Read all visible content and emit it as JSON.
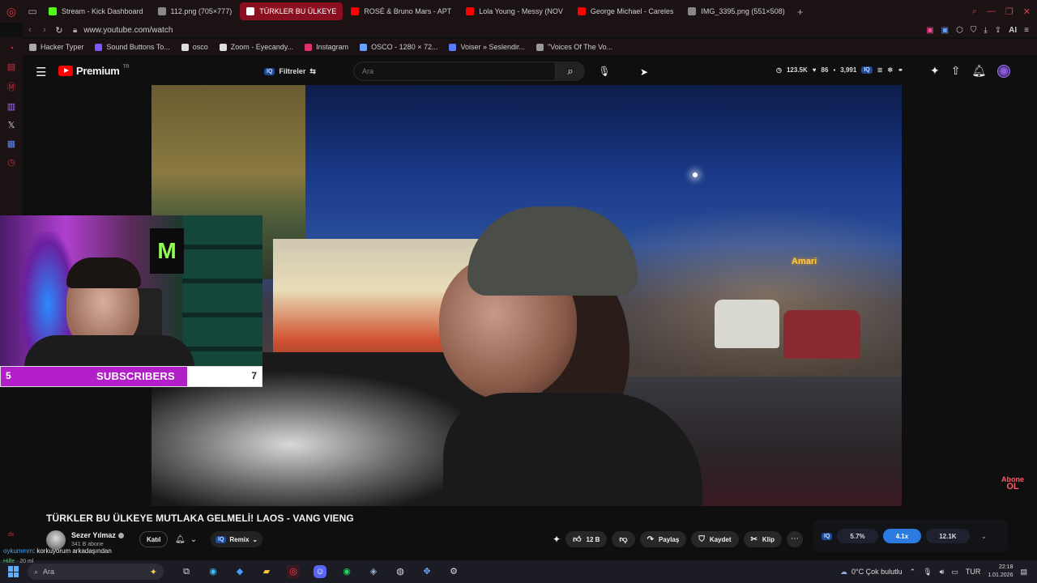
{
  "browser": {
    "tabs": [
      {
        "label": "Stream - Kick Dashboard",
        "fav_color": "#53fc18",
        "active": false
      },
      {
        "label": "112.png (705×777)",
        "fav_color": "#888888",
        "active": false
      },
      {
        "label": "TÜRKLER BU ÜLKEYE",
        "fav_color": "#ffffff",
        "active": true
      },
      {
        "label": "ROSÉ & Bruno Mars - APT",
        "fav_color": "#ff0000",
        "active": false
      },
      {
        "label": "Lola Young - Messy (NOV",
        "fav_color": "#ff0000",
        "active": false
      },
      {
        "label": "George Michael - Careles",
        "fav_color": "#ff0000",
        "active": false
      },
      {
        "label": "IMG_3395.png (551×508)",
        "fav_color": "#888888",
        "active": false
      }
    ],
    "url": "www.youtube.com/watch",
    "ai_label": "AI",
    "bookmarks": [
      {
        "label": "Hacker Typer",
        "icon": "chevron-right-icon",
        "color": "#aaaaaa"
      },
      {
        "label": "Sound Buttons To...",
        "icon": "bars-icon",
        "color": "#7a5aff"
      },
      {
        "label": "osco",
        "icon": "dot-icon",
        "color": "#dddddd"
      },
      {
        "label": "Zoom - Eyecandy...",
        "icon": "zoom-icon",
        "color": "#dddddd"
      },
      {
        "label": "Instagram",
        "icon": "instagram-icon",
        "color": "#e1306c"
      },
      {
        "label": "OSCO - 1280 × 72...",
        "icon": "globe-icon",
        "color": "#6aa0ff"
      },
      {
        "label": "Voiser » Seslendir...",
        "icon": "voiser-icon",
        "color": "#5a7aff"
      },
      {
        "label": "\"Voices Of The Vo...",
        "icon": "image-icon",
        "color": "#999999"
      }
    ]
  },
  "youtube": {
    "logo_text": "Premium",
    "region": "TR",
    "filter_label": "Filtreler",
    "iq_label": "IQ",
    "search_placeholder": "Ara",
    "stats": {
      "views": "123.5K",
      "likes": "86",
      "count": "3,991"
    }
  },
  "webcam": {
    "monster_letter": "M",
    "sub_count": "5",
    "sub_label": "SUBSCRIBERS",
    "sub_goal": "7",
    "sub_progress": 0.714
  },
  "video": {
    "title": "TÜRKLER BU ÜLKEYE MUTLAKA GELMELİ! LAOS - VANG VIENG",
    "sign_text": "Amari",
    "abone_top": "Abone",
    "abone_bottom": "OL"
  },
  "channel": {
    "name": "Sezer Yılmaz",
    "subs": "341 B abone",
    "join_label": "Katıl",
    "remix_label": "Remix"
  },
  "actions": {
    "like_count": "12 B",
    "share_label": "Paylaş",
    "save_label": "Kaydet",
    "clip_label": "Klip"
  },
  "iq_panel": {
    "stat1": "5.7%",
    "stat2": "4.1x",
    "stat3": "12.1K"
  },
  "chat": {
    "tag": "dx",
    "user": "oykummm",
    "message": ": korkuyorum arkadaşından",
    "line2": "Hilfe",
    "line2_extra": "· 20 ml"
  },
  "taskbar": {
    "search_placeholder": "Ara",
    "weather": "0°C  Çok bulutlu",
    "lang": "TUR",
    "time": "22:18",
    "date": "1.01.2026"
  }
}
